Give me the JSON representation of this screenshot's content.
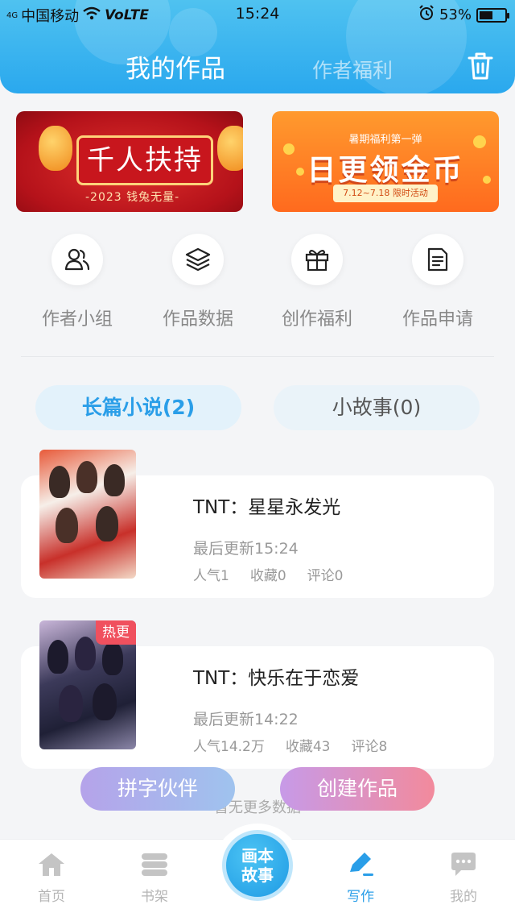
{
  "status_bar": {
    "network": "4G",
    "carrier": "中国移动",
    "volte": "VoLTE",
    "time": "15:24",
    "battery": "53%",
    "battery_level": 0.53
  },
  "header": {
    "tab_active": "我的作品",
    "tab_inactive": "作者福利",
    "trash_icon": "trash-icon"
  },
  "banners": {
    "left": {
      "title": "千人扶持",
      "subtitle": "-2023 钱兔无量-"
    },
    "right": {
      "top": "暑期福利第一弹",
      "title": "日更领金币",
      "subtitle": "7.12~7.18 限时活动"
    }
  },
  "quick_actions": [
    {
      "icon": "group-icon",
      "label": "作者小组"
    },
    {
      "icon": "layers-icon",
      "label": "作品数据"
    },
    {
      "icon": "gift-icon",
      "label": "创作福利"
    },
    {
      "icon": "document-icon",
      "label": "作品申请"
    }
  ],
  "segments": {
    "long": "长篇小说(2)",
    "short": "小故事(0)"
  },
  "works": [
    {
      "title": "TNT：星星永发光",
      "updated": "最后更新15:24",
      "popularity": "人气1",
      "favorites": "收藏0",
      "comments": "评论0"
    },
    {
      "badge": "热更",
      "title": "TNT：快乐在于恋爱",
      "updated": "最后更新14:22",
      "popularity": "人气14.2万",
      "favorites": "收藏43",
      "comments": "评论8"
    }
  ],
  "footer_text": "暂无更多数据",
  "floating_buttons": {
    "partner": "拼字伙伴",
    "create": "创建作品"
  },
  "bottom_nav": {
    "home": "首页",
    "shelf": "书架",
    "center_line1": "画本",
    "center_line2": "故事",
    "write": "写作",
    "mine": "我的"
  },
  "colors": {
    "accent": "#2a9ee8",
    "header": "#3fb5ef",
    "hot_badge": "#f0505e"
  }
}
